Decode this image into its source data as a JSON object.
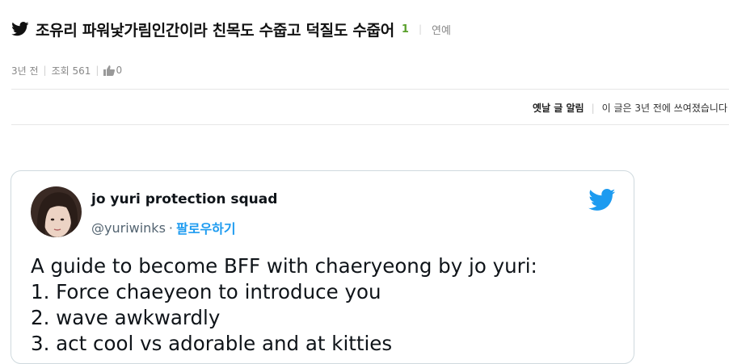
{
  "post": {
    "title": "조유리 파워낯가림인간이라 친목도 수줍고 덕질도 수줍어",
    "comment_count": "1",
    "category": "연예",
    "time": "3년 전",
    "views": "조회 561",
    "likes": "0"
  },
  "old_notice": {
    "label": "옛날 글 알림",
    "message": "이 글은 3년 전에 쓰여졌습니다"
  },
  "tweet": {
    "author_name": "jo yuri protection squad",
    "handle": "@yuriwinks",
    "follow_label": "팔로우하기",
    "lines": [
      "A guide to become BFF with chaeryeong by jo yuri:",
      "1. Force chaeyeon to introduce you",
      "2. wave awkwardly",
      "3. act cool vs adorable and at kitties"
    ]
  },
  "colors": {
    "twitter_blue": "#1d9bf0",
    "comment_green": "#5aa02c"
  },
  "icons": [
    "twitter-bird-icon",
    "thumbs-up-icon",
    "twitter-logo-icon"
  ]
}
